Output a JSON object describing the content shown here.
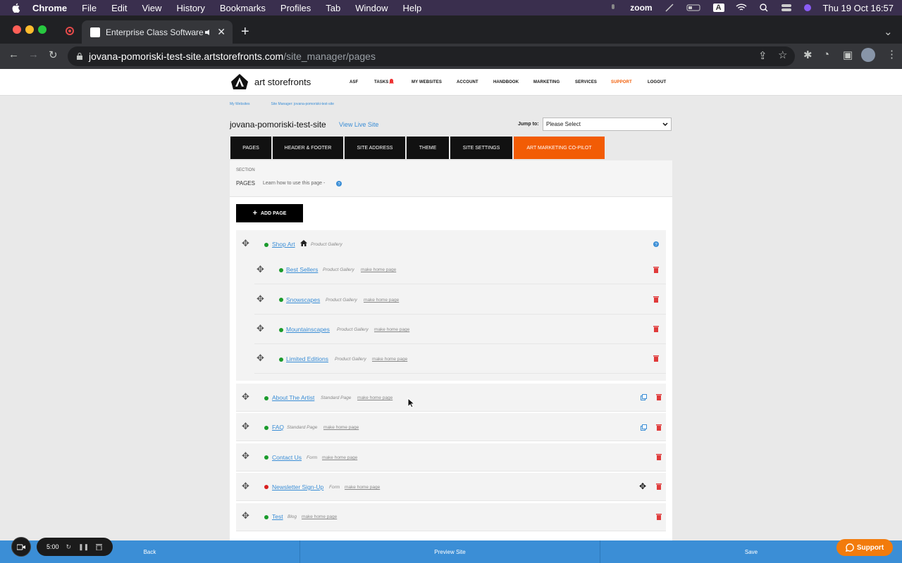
{
  "menubar": {
    "app": "Chrome",
    "items": [
      "File",
      "Edit",
      "View",
      "History",
      "Bookmarks",
      "Profiles",
      "Tab",
      "Window",
      "Help"
    ],
    "zoom": "zoom",
    "keyboard": "A",
    "datetime": "Thu 19 Oct  16:57"
  },
  "browser": {
    "tab_title": "Enterprise Class Software",
    "url_host": "jovana-pomoriski-test-site.artstorefronts.com",
    "url_path": "/site_manager/pages"
  },
  "site": {
    "logo_text": "art storefronts",
    "nav": [
      "ASF",
      "TASKS",
      "MY WEBSITES",
      "ACCOUNT",
      "HANDBOOK",
      "MARKETING",
      "SERVICES",
      "SUPPORT",
      "LOGOUT"
    ],
    "accent": "#f25c05",
    "link_color": "#3b8ed6"
  },
  "breadcrumb": [
    "My Websites",
    "Site Manager: jovana-pomoriski-test-site"
  ],
  "header": {
    "site_name": "jovana-pomoriski-test-site",
    "view_live": "View Live Site",
    "jump_label": "Jump to:",
    "jump_value": "Please Select"
  },
  "tabs": [
    "PAGES",
    "HEADER & FOOTER",
    "SITE ADDRESS",
    "THEME",
    "SITE SETTINGS",
    "ART MARKETING CO-PILOT"
  ],
  "section": {
    "label": "SECTION",
    "title": "PAGES",
    "help": "Learn how to use this page -"
  },
  "add_page": "ADD PAGE",
  "pages": {
    "root": {
      "name": "Shop Art",
      "type": "Product Gallery",
      "status": "#1a9b2c"
    },
    "children": [
      {
        "name": "Best Sellers",
        "type": "Product Gallery",
        "action": "make home page"
      },
      {
        "name": "Snowscapes",
        "type": "Product Gallery",
        "action": "make home page"
      },
      {
        "name": "Mountainscapes",
        "type": "Product Gallery",
        "action": "make home page"
      },
      {
        "name": "Limited Editions",
        "type": "Product Gallery",
        "action": "make home page"
      }
    ],
    "top": [
      {
        "name": "About The Artist",
        "type": "Standard Page",
        "action": "make home page"
      },
      {
        "name": "FAQ",
        "type": "Standard Page",
        "action": "make home page"
      },
      {
        "name": "Contact Us",
        "type": "Form",
        "action": "make home page"
      },
      {
        "name": "Newsletter Sign-Up",
        "type": "Form",
        "action": "make home page"
      },
      {
        "name": "Test",
        "type": "Blog",
        "action": "make home page"
      }
    ]
  },
  "bottom": {
    "back": "Back",
    "preview": "Preview Site",
    "save": "Save"
  },
  "recorder": {
    "time": "5:00"
  },
  "support_button": "Support"
}
